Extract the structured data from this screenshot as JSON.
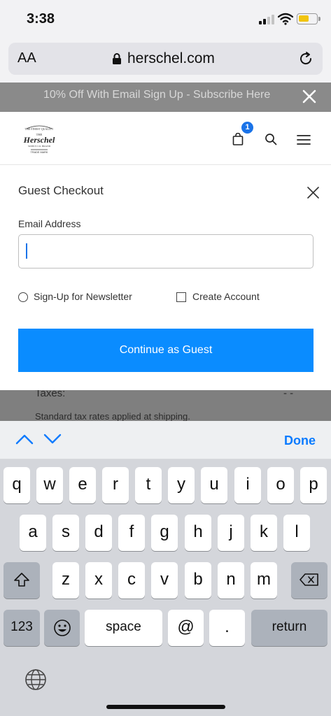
{
  "status_bar": {
    "time": "3:38"
  },
  "browser": {
    "text_size_label": "AA",
    "url": "herschel.com"
  },
  "promo": {
    "text": "10% Off With Email Sign Up - Subscribe Here"
  },
  "header": {
    "cart_count": "1"
  },
  "modal": {
    "title": "Guest Checkout",
    "email_label": "Email Address",
    "email_value": "",
    "newsletter_label": "Sign-Up for Newsletter",
    "create_account_label": "Create Account",
    "continue_label": "Continue as Guest"
  },
  "background": {
    "taxes_label": "Taxes:",
    "taxes_value": "- -",
    "tax_note": "Standard tax rates applied at shipping."
  },
  "accessory": {
    "done_label": "Done"
  },
  "keyboard": {
    "row1": [
      "q",
      "w",
      "e",
      "r",
      "t",
      "y",
      "u",
      "i",
      "o",
      "p"
    ],
    "row2": [
      "a",
      "s",
      "d",
      "f",
      "g",
      "h",
      "j",
      "k",
      "l"
    ],
    "row3": [
      "z",
      "x",
      "c",
      "v",
      "b",
      "n",
      "m"
    ],
    "numbers_label": "123",
    "space_label": "space",
    "at_label": "@",
    "dot_label": ".",
    "return_label": "return"
  },
  "colors": {
    "accent": "#0a8cff",
    "badge": "#1a73e8",
    "done": "#0a7bff"
  }
}
